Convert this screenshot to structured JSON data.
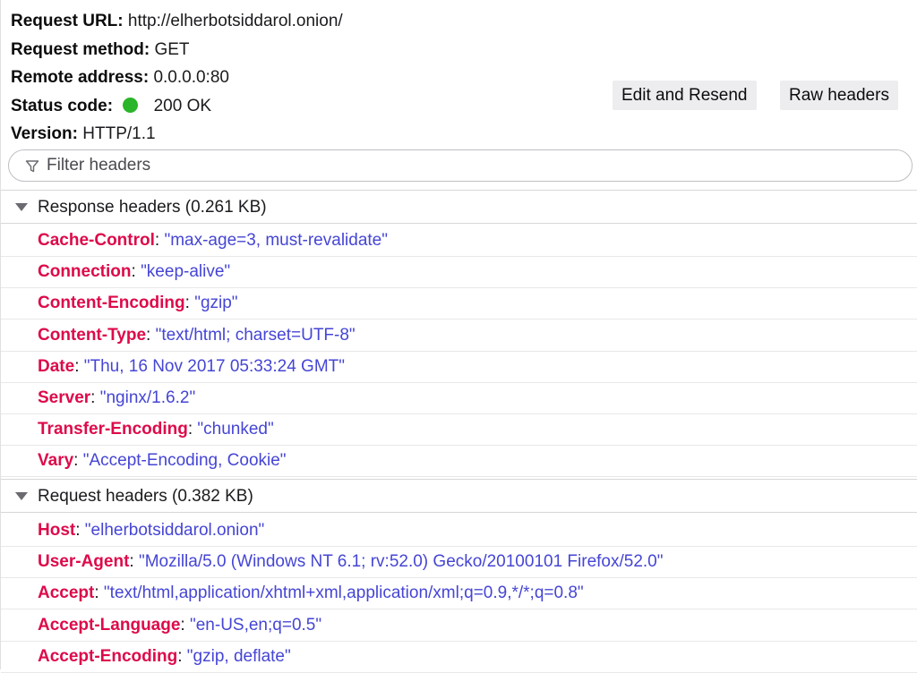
{
  "summary": {
    "request_url_label": "Request URL:",
    "request_url_value": "http://elherbotsiddarol.onion/",
    "request_method_label": "Request method:",
    "request_method_value": "GET",
    "remote_address_label": "Remote address:",
    "remote_address_value": "0.0.0.0:80",
    "status_code_label": "Status code:",
    "status_code_value": "200 OK",
    "status_color": "#2ab52a",
    "version_label": "Version:",
    "version_value": "HTTP/1.1"
  },
  "toolbar": {
    "edit_resend_label": "Edit and Resend",
    "raw_headers_label": "Raw headers"
  },
  "filter": {
    "placeholder": "Filter headers",
    "icon": "filter-funnel-icon"
  },
  "colors": {
    "header_name": "#dd0a4a",
    "header_value": "#4545d5"
  },
  "response_headers": {
    "title": "Response headers (0.261 KB)",
    "items": [
      {
        "name": "Cache-Control",
        "value": "\"max-age=3, must-revalidate\""
      },
      {
        "name": "Connection",
        "value": "\"keep-alive\""
      },
      {
        "name": "Content-Encoding",
        "value": "\"gzip\""
      },
      {
        "name": "Content-Type",
        "value": "\"text/html; charset=UTF-8\""
      },
      {
        "name": "Date",
        "value": "\"Thu, 16 Nov 2017 05:33:24 GMT\""
      },
      {
        "name": "Server",
        "value": "\"nginx/1.6.2\""
      },
      {
        "name": "Transfer-Encoding",
        "value": "\"chunked\""
      },
      {
        "name": "Vary",
        "value": "\"Accept-Encoding, Cookie\""
      }
    ]
  },
  "request_headers": {
    "title": "Request headers (0.382 KB)",
    "items": [
      {
        "name": "Host",
        "value": "\"elherbotsiddarol.onion\""
      },
      {
        "name": "User-Agent",
        "value": "\"Mozilla/5.0 (Windows NT 6.1; rv:52.0) Gecko/20100101 Firefox/52.0\""
      },
      {
        "name": "Accept",
        "value": "\"text/html,application/xhtml+xml,application/xml;q=0.9,*/*;q=0.8\""
      },
      {
        "name": "Accept-Language",
        "value": "\"en-US,en;q=0.5\""
      },
      {
        "name": "Accept-Encoding",
        "value": "\"gzip, deflate\""
      }
    ]
  }
}
